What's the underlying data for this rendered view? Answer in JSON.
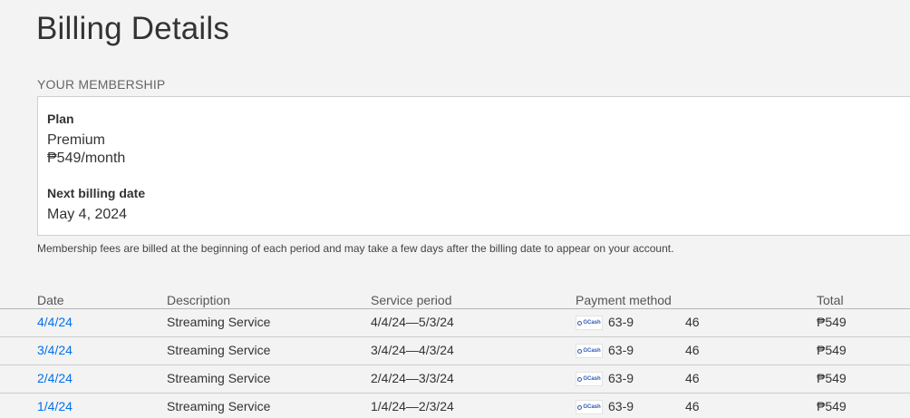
{
  "page": {
    "title": "Billing Details"
  },
  "membership": {
    "section_label": "YOUR MEMBERSHIP",
    "plan_label": "Plan",
    "plan_name": "Premium",
    "plan_price": "₱549/month",
    "next_billing_label": "Next billing date",
    "next_billing_date": "May 4, 2024",
    "footnote": "Membership fees are billed at the beginning of each period and may take a few days after the billing date to appear on your account."
  },
  "table": {
    "headers": {
      "date": "Date",
      "description": "Description",
      "service_period": "Service period",
      "payment_method": "Payment method",
      "total": "Total"
    },
    "rows": [
      {
        "date": "4/4/24",
        "description": "Streaming Service",
        "service_period": "4/4/24—5/3/24",
        "payment_logo": "GCash",
        "payment_prefix": "63-9",
        "payment_suffix": "46",
        "total": "₱549"
      },
      {
        "date": "3/4/24",
        "description": "Streaming Service",
        "service_period": "3/4/24—4/3/24",
        "payment_logo": "GCash",
        "payment_prefix": "63-9",
        "payment_suffix": "46",
        "total": "₱549"
      },
      {
        "date": "2/4/24",
        "description": "Streaming Service",
        "service_period": "2/4/24—3/3/24",
        "payment_logo": "GCash",
        "payment_prefix": "63-9",
        "payment_suffix": "46",
        "total": "₱549"
      },
      {
        "date": "1/4/24",
        "description": "Streaming Service",
        "service_period": "1/4/24—2/3/24",
        "payment_logo": "GCash",
        "payment_prefix": "63-9",
        "payment_suffix": "46",
        "total": "₱549"
      }
    ]
  },
  "colors": {
    "background": "#f3f3f3",
    "link": "#0071eb",
    "gcash_brand": "#2d57b8"
  }
}
